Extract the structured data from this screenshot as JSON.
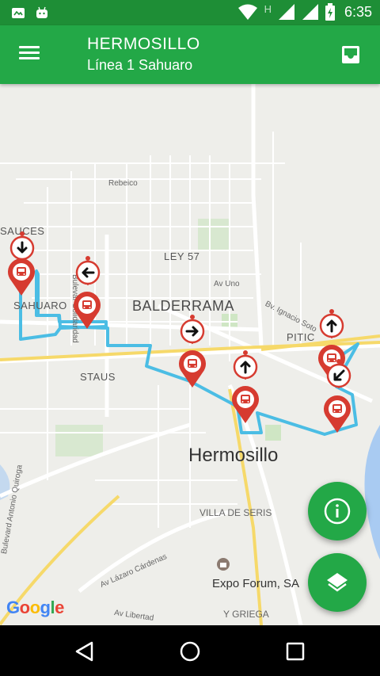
{
  "status_bar": {
    "time": "6:35",
    "icons": [
      "photo-notification-icon",
      "android-notification-icon",
      "wifi-icon",
      "h-network-icon",
      "signal-icon",
      "signal-icon",
      "battery-charging-icon"
    ],
    "network_letter": "H"
  },
  "app_bar": {
    "city": "HERMOSILLO",
    "route": "Línea 1 Sahuaro",
    "menu_icon": "hamburger-menu-icon",
    "inbox_icon": "inbox-icon",
    "color": "#23a847"
  },
  "map": {
    "labels": {
      "balderrama": "BALDERRAMA",
      "hermosillo": "Hermosillo",
      "sauces": "SAUCES",
      "sahuaro": "SAHUARO",
      "staus": "STAUS",
      "pitic": "PITIC",
      "ley57": "LEY 57",
      "rebeico": "Rebeico",
      "av_uno": "Av Uno",
      "bulevar_solidaridad": "Bulevar Solidaridad",
      "bv_ignacio_soto": "Bv. Ignacio Soto",
      "villa_de_seris": "VILLA DE SERIS",
      "av_lazaro_cardenas": "Av Lázaro Cárdenas",
      "bulevard_antonio_quiroga": "Bulevard Antonio Quiroga",
      "expo_forum": "Expo Forum, SA",
      "av_libertad": "Av Libertad",
      "y_griega": "Y GRIEGA"
    },
    "route_color": "#4bbde4",
    "marker_color": "#d63b30",
    "stop_markers": [
      {
        "name": "stop-1",
        "direction": "down"
      },
      {
        "name": "stop-2",
        "direction": "left"
      },
      {
        "name": "stop-3",
        "direction": "right"
      },
      {
        "name": "stop-4",
        "direction": "up"
      },
      {
        "name": "stop-5",
        "direction": "up"
      },
      {
        "name": "stop-6",
        "direction": "down-left"
      }
    ],
    "google_logo": [
      "G",
      "o",
      "o",
      "g",
      "l",
      "e"
    ]
  },
  "fabs": {
    "info_icon": "info-icon",
    "layers_icon": "layers-icon"
  },
  "nav_bar": {
    "back_icon": "back-icon",
    "home_icon": "home-icon",
    "recents_icon": "recents-icon"
  }
}
